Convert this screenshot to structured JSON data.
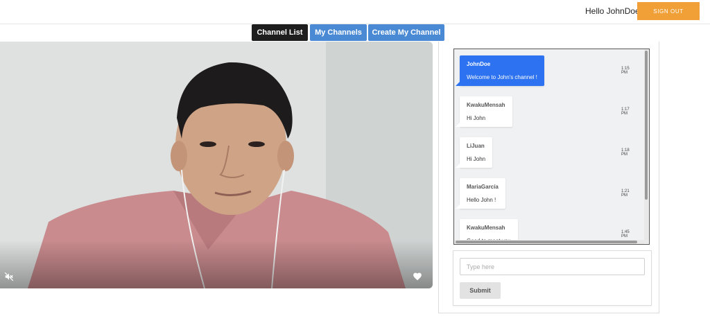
{
  "header": {
    "greeting": "Hello JohnDoe",
    "signout_label": "SIGN OUT",
    "signout_color": "#f0a037"
  },
  "tabs": [
    {
      "label": "Channel List",
      "active": true
    },
    {
      "label": "My Channels",
      "active": false
    },
    {
      "label": "Create My Channel",
      "active": false
    }
  ],
  "video": {
    "muted": true,
    "mute_icon": "volume-off-icon",
    "like_icon": "heart-icon"
  },
  "chat": {
    "messages": [
      {
        "author": "JohnDoe",
        "text": "Welcome to John's channel !",
        "time": "1:15 PM",
        "own": true
      },
      {
        "author": "KwakuMensah",
        "text": "Hi John",
        "time": "1:17 PM",
        "own": false
      },
      {
        "author": "LiJuan",
        "text": "Hi John",
        "time": "1:18 PM",
        "own": false
      },
      {
        "author": "MariaGarcía",
        "text": "Hello John !",
        "time": "1:21 PM",
        "own": false
      },
      {
        "author": "KwakuMensah",
        "text": "Good to meet you",
        "time": "1:45 PM",
        "own": false
      }
    ],
    "input_placeholder": "Type here",
    "submit_label": "Submit",
    "own_bubble_color": "#2d72f0"
  }
}
